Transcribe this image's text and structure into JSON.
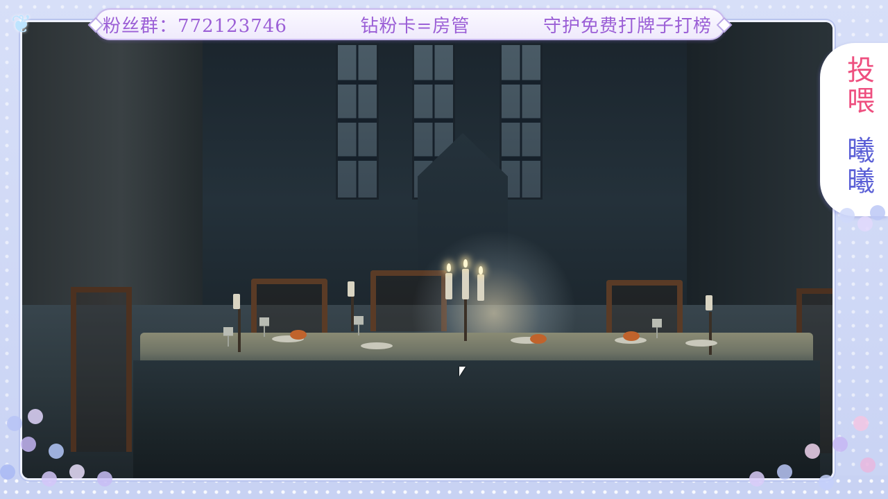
{
  "banner": {
    "fan_group": "粉丝群：772123746",
    "diamond_card": "钻粉卡=房管",
    "guard": "守护免费打牌子打榜"
  },
  "side_panel": {
    "feed_label": "投喂",
    "name_label": "曦曦"
  },
  "colors": {
    "banner_text": "#9b5fd6",
    "feed_text": "#ee4f7f",
    "name_text": "#5a5fd6",
    "frame": "#cfd9f7"
  },
  "icons": [
    "butterfly-icon",
    "mouse-cursor-icon"
  ]
}
